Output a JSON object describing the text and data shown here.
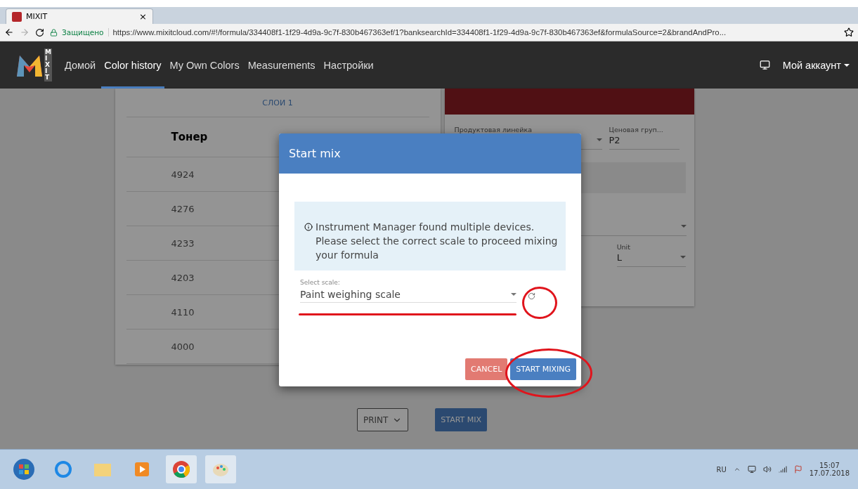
{
  "browser": {
    "tab": {
      "title": "MIXIT",
      "close": "×"
    },
    "security": "Защищено",
    "url": "https://www.mixitcloud.com/#!/formula/334408f1-1f29-4d9a-9c7f-830b467363ef/1?banksearchId=334408f1-1f29-4d9a-9c7f-830b467363ef&formulaSource=2&brandAndPro..."
  },
  "nav": {
    "logo": "MIXIT",
    "items": [
      {
        "label": "Домой",
        "selected": false
      },
      {
        "label": "Color history",
        "selected": true
      },
      {
        "label": "My Own Colors",
        "selected": false
      },
      {
        "label": "Measurements",
        "selected": false
      },
      {
        "label": "Настройки",
        "selected": false
      }
    ],
    "account": "Мой аккаунт"
  },
  "layers_tab": "СЛОИ 1",
  "table": {
    "header": "Тонер",
    "rows": [
      "4924",
      "4276",
      "4233",
      "4203",
      "4110",
      "4000"
    ]
  },
  "details": {
    "product_label": "Продуктовая линейка",
    "price_group": {
      "label": "Ценовая груп...",
      "value": "P2"
    },
    "unit": {
      "label": "Unit",
      "value": "L"
    }
  },
  "modal": {
    "title": "Start mix",
    "info": "Instrument Manager found multiple devices. Please select the correct scale to proceed mixing your formula",
    "select": {
      "label": "Select scale:",
      "value": "Paint weighing scale"
    },
    "buttons": [
      {
        "label": "CANCEL",
        "kind": "cancel"
      },
      {
        "label": "START MIXING",
        "kind": "primary"
      }
    ]
  },
  "actions": {
    "print": "PRINT",
    "start": "START MIX"
  },
  "taskbar": {
    "language": "RU",
    "time": "15:07",
    "date": "17.07.2018"
  }
}
